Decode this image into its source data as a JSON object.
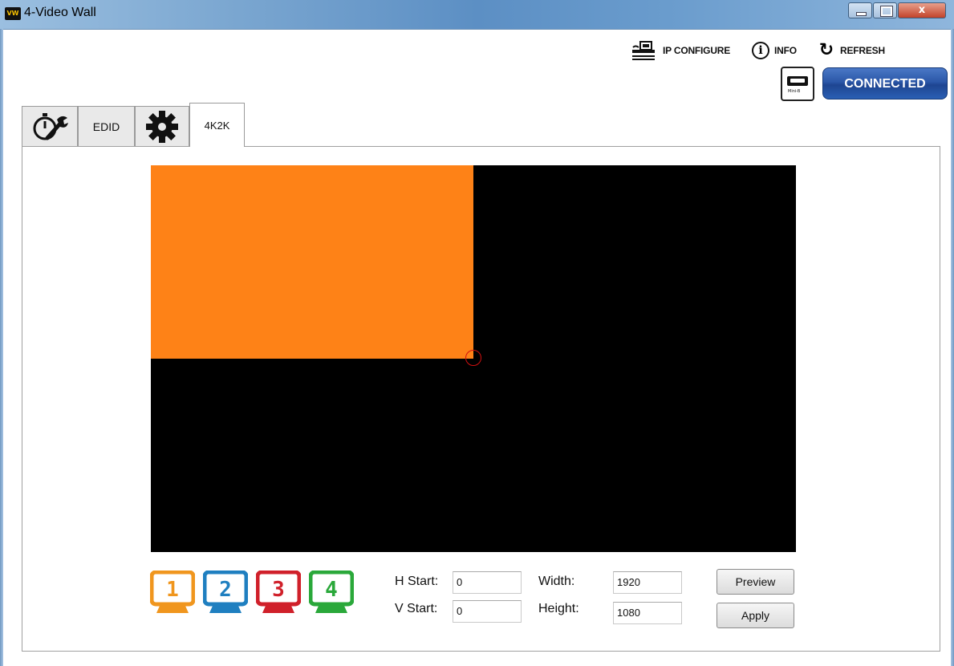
{
  "window": {
    "title": "4-Video Wall",
    "logo_text": "VW",
    "close_glyph": "x"
  },
  "toolbar": {
    "ip_configure": "IP CONFIGURE",
    "info": "INFO",
    "info_glyph": "i",
    "refresh": "REFRESH",
    "refresh_glyph": "↻",
    "usb_label": "Mini-B",
    "connection_status": "CONNECTED"
  },
  "tabs": {
    "edid": "EDID",
    "active": "4K2K"
  },
  "monitors": [
    {
      "label": "1",
      "color": "#f0961e"
    },
    {
      "label": "2",
      "color": "#1f7fc0"
    },
    {
      "label": "3",
      "color": "#d0202a"
    },
    {
      "label": "4",
      "color": "#2aa83a"
    }
  ],
  "region_color": "#fe8217",
  "fields": {
    "h_start": {
      "label": "H Start:",
      "value": "0"
    },
    "v_start": {
      "label": "V Start:",
      "value": "0"
    },
    "width": {
      "label": "Width:",
      "value": "1920"
    },
    "height": {
      "label": "Height:",
      "value": "1080"
    }
  },
  "buttons": {
    "preview": "Preview",
    "apply": "Apply"
  },
  "icons": {
    "ip_configure": "network-device-icon",
    "info": "info-icon",
    "refresh": "refresh-icon",
    "usb": "usb-mini-b-icon",
    "tools": "stopwatch-wrench-icon",
    "settings": "gear-icon"
  }
}
